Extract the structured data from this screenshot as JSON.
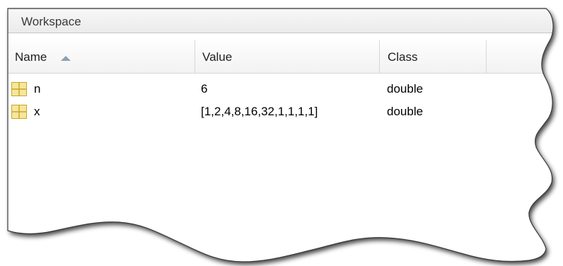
{
  "panel": {
    "title": "Workspace"
  },
  "columns": {
    "name": "Name",
    "value": "Value",
    "class": "Class"
  },
  "variables": [
    {
      "name": "n",
      "value": "6",
      "class": "double",
      "icon": "matrix-icon"
    },
    {
      "name": "x",
      "value": "[1,2,4,8,16,32,1,1,1,1]",
      "class": "double",
      "icon": "matrix-icon"
    }
  ],
  "colors": {
    "icon_fill": "#f5e79b",
    "icon_border": "#c9a52c",
    "sort_indicator": "#8aa1b4"
  },
  "sort": {
    "column": "name",
    "direction": "ascending"
  }
}
